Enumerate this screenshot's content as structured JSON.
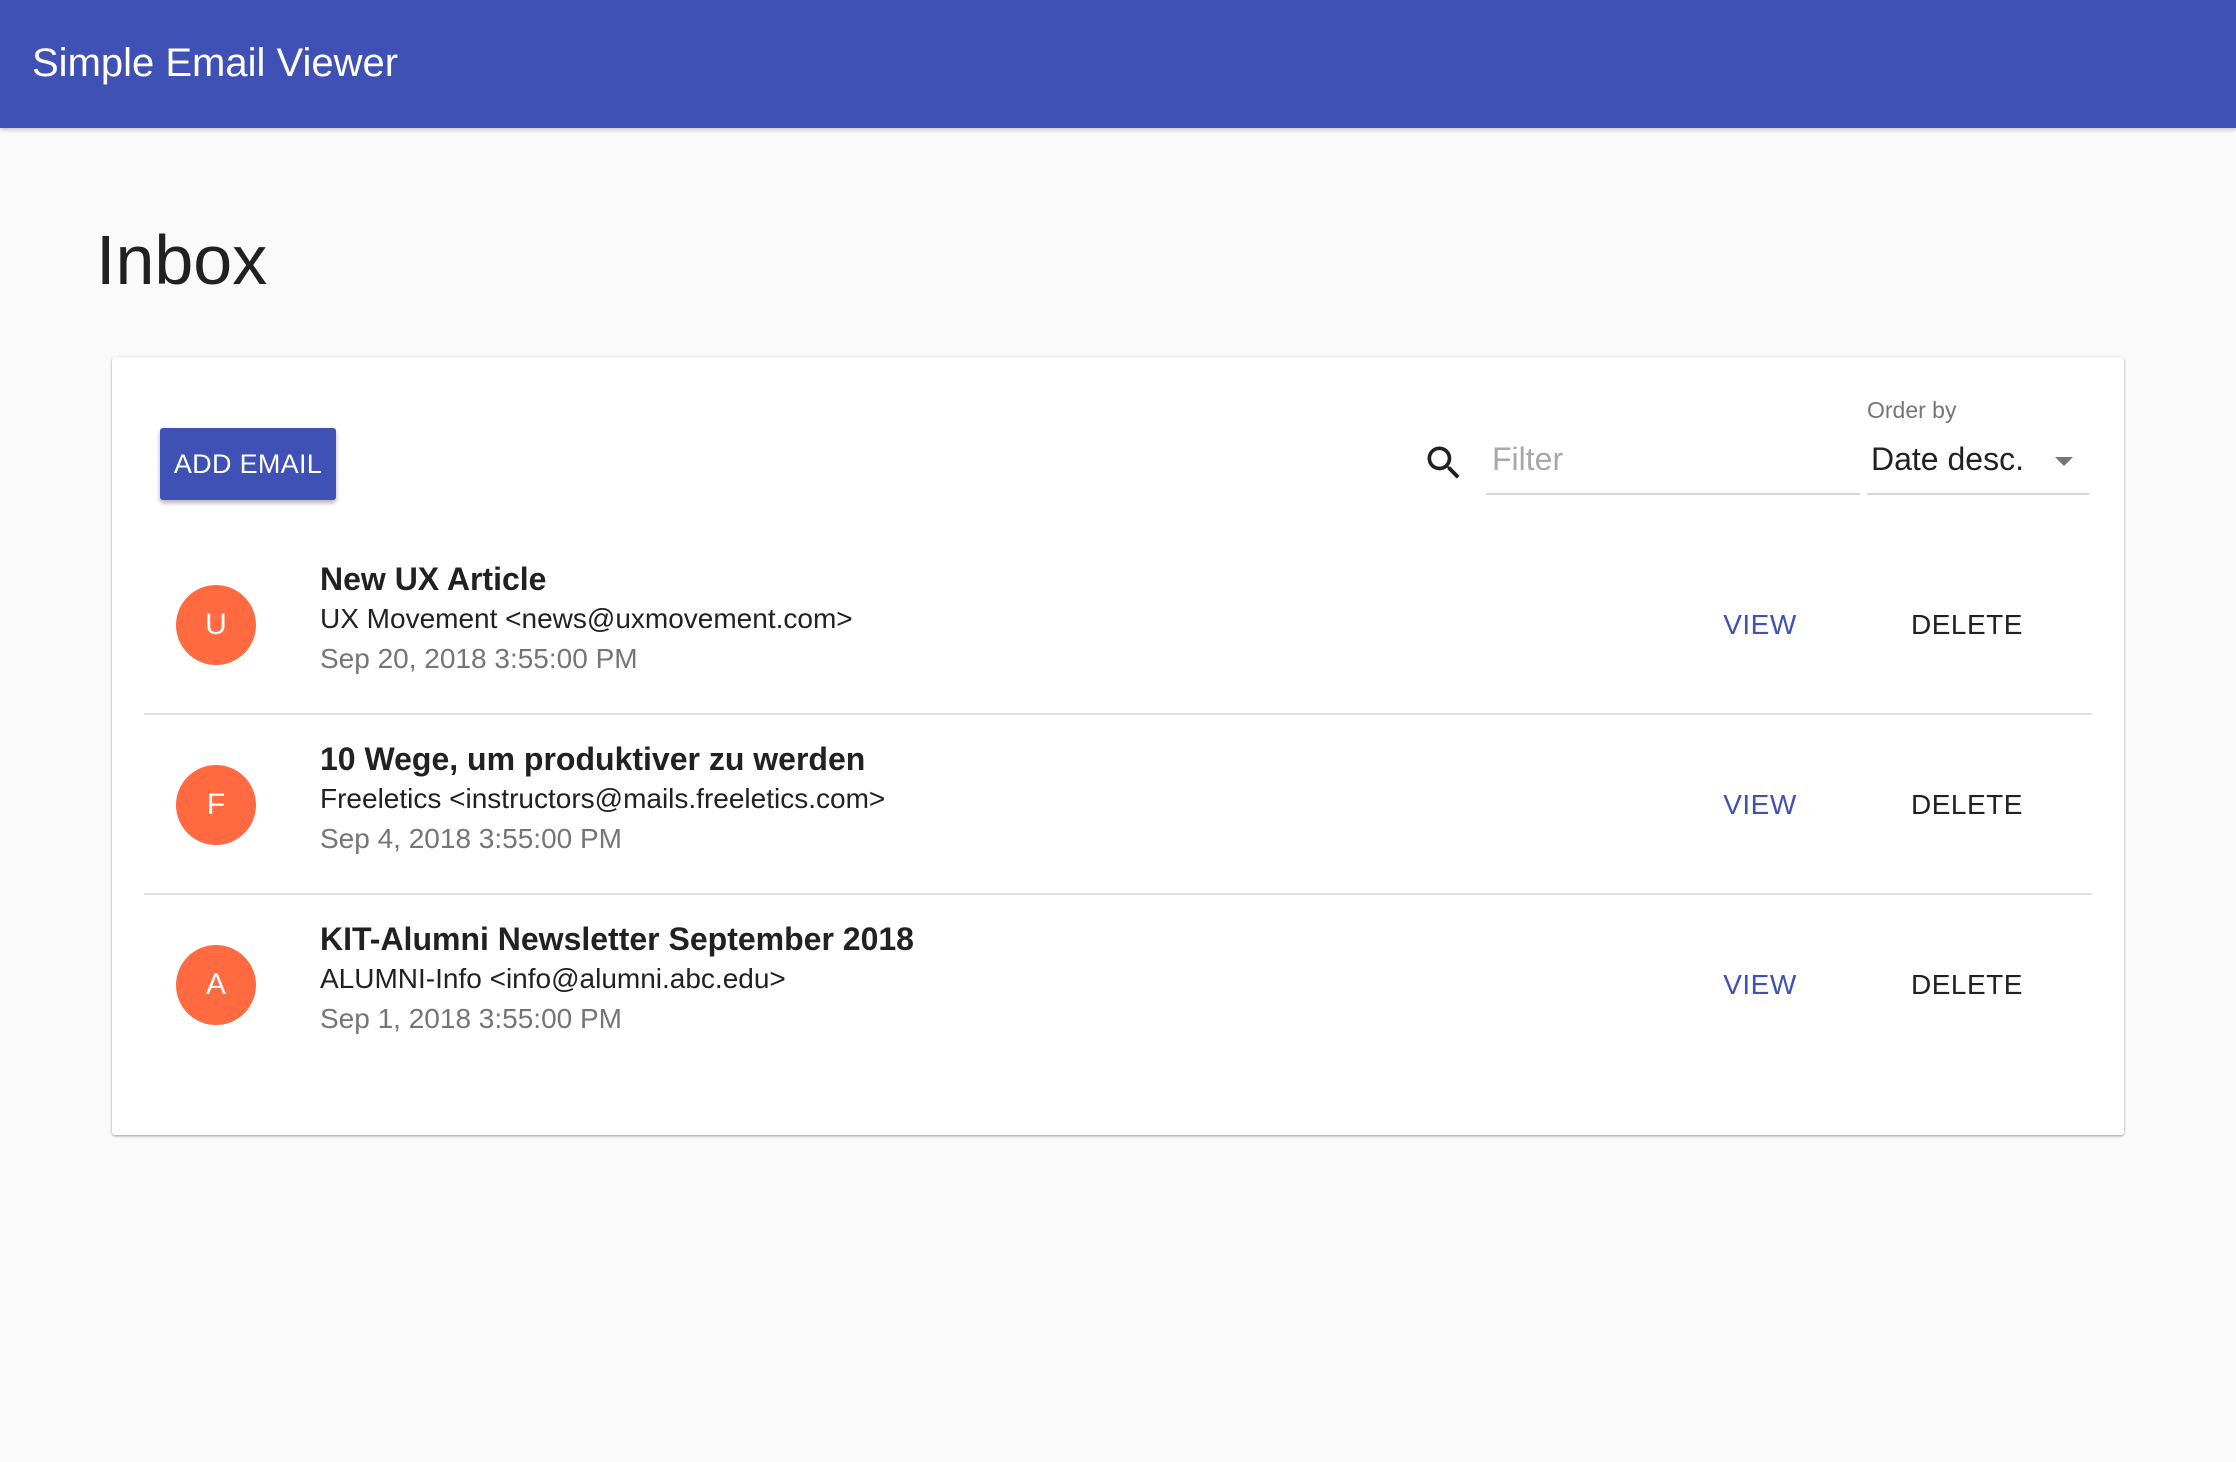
{
  "app": {
    "title": "Simple Email Viewer"
  },
  "page": {
    "title": "Inbox"
  },
  "toolbar": {
    "add_label": "ADD EMAIL",
    "filter_placeholder": "Filter",
    "filter_value": "",
    "order_label": "Order by",
    "order_value": "Date desc."
  },
  "emails": [
    {
      "initial": "U",
      "subject": "New UX Article",
      "from": "UX Movement <news@uxmovement.com>",
      "date": "Sep 20, 2018 3:55:00 PM",
      "view_label": "VIEW",
      "delete_label": "DELETE"
    },
    {
      "initial": "F",
      "subject": "10 Wege, um produktiver zu werden",
      "from": "Freeletics <instructors@mails.freeletics.com>",
      "date": "Sep 4, 2018 3:55:00 PM",
      "view_label": "VIEW",
      "delete_label": "DELETE"
    },
    {
      "initial": "A",
      "subject": "KIT-Alumni Newsletter September 2018",
      "from": "ALUMNI-Info <info@alumni.abc.edu>",
      "date": "Sep 1, 2018 3:55:00 PM",
      "view_label": "VIEW",
      "delete_label": "DELETE"
    }
  ],
  "icons": {
    "search": "search-icon",
    "dropdown": "arrow-drop-down-icon"
  },
  "colors": {
    "primary": "#3f51b5",
    "avatar": "#ff6a40",
    "background": "#fafafa"
  }
}
